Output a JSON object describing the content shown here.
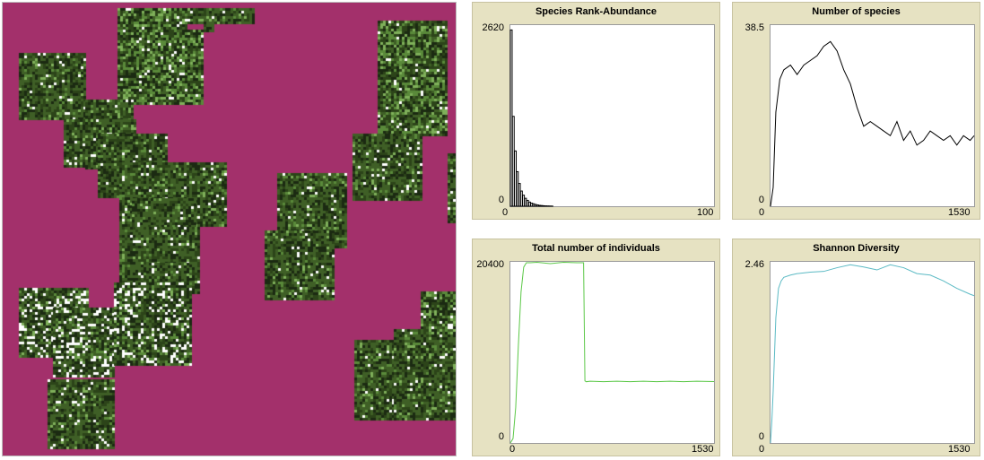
{
  "world": {
    "background": "#a3306b",
    "patch_colors": [
      "#1b2a12",
      "#2c4419",
      "#3f5f26",
      "#5a8a3a",
      "#7fb05a",
      "#ffffff"
    ]
  },
  "plots": [
    {
      "id": "rank",
      "title": "Species Rank-Abundance",
      "y_max_label": "2620",
      "y_min_label": "0",
      "x_min_label": "0",
      "x_max_label": "100",
      "color": "#000000",
      "chart_data": {
        "type": "bar",
        "x": [
          0,
          1,
          2,
          3,
          4,
          5,
          6,
          7,
          8,
          9,
          10,
          11,
          12,
          13,
          14,
          15,
          16,
          17,
          18,
          19,
          20
        ],
        "values": [
          2550,
          1300,
          800,
          500,
          330,
          220,
          160,
          115,
          85,
          60,
          45,
          35,
          25,
          18,
          13,
          10,
          7,
          5,
          4,
          3,
          2
        ],
        "xlim": [
          0,
          100
        ],
        "ylim": [
          0,
          2620
        ]
      }
    },
    {
      "id": "species",
      "title": "Number of species",
      "y_max_label": "38.5",
      "y_min_label": "0",
      "x_min_label": "0",
      "x_max_label": "1530",
      "color": "#000000",
      "chart_data": {
        "type": "line",
        "x": [
          0,
          20,
          40,
          70,
          100,
          150,
          200,
          250,
          300,
          350,
          400,
          450,
          500,
          550,
          600,
          650,
          700,
          750,
          800,
          850,
          900,
          950,
          1000,
          1050,
          1100,
          1150,
          1200,
          1250,
          1300,
          1350,
          1400,
          1450,
          1500,
          1530
        ],
        "y": [
          0,
          4,
          20,
          27,
          29,
          30,
          28,
          30,
          31,
          32,
          34,
          35,
          33,
          29,
          26,
          21,
          17,
          18,
          17,
          16,
          15,
          18,
          14,
          16,
          13,
          14,
          16,
          15,
          14,
          15,
          13,
          15,
          14,
          15
        ],
        "xlim": [
          0,
          1530
        ],
        "ylim": [
          0,
          38.5
        ]
      }
    },
    {
      "id": "individuals",
      "title": "Total number of individuals",
      "y_max_label": "20400",
      "y_min_label": "0",
      "x_min_label": "0",
      "x_max_label": "1530",
      "color": "#5cc848",
      "chart_data": {
        "type": "line",
        "x": [
          0,
          20,
          40,
          60,
          80,
          100,
          120,
          150,
          200,
          300,
          400,
          500,
          550,
          560,
          570,
          600,
          700,
          800,
          900,
          1000,
          1100,
          1200,
          1300,
          1400,
          1530
        ],
        "y": [
          0,
          500,
          4000,
          11000,
          17000,
          19800,
          20300,
          20300,
          20350,
          20200,
          20350,
          20300,
          20300,
          7000,
          6900,
          6950,
          6900,
          6950,
          6900,
          6950,
          6900,
          6950,
          6900,
          6950,
          6920
        ],
        "xlim": [
          0,
          1530
        ],
        "ylim": [
          0,
          20400
        ]
      }
    },
    {
      "id": "shannon",
      "title": "Shannon Diversity",
      "y_max_label": "2.46",
      "y_min_label": "0",
      "x_min_label": "0",
      "x_max_label": "1530",
      "color": "#5bbac4",
      "chart_data": {
        "type": "line",
        "x": [
          0,
          10,
          20,
          40,
          60,
          80,
          100,
          150,
          200,
          300,
          400,
          500,
          600,
          700,
          800,
          900,
          1000,
          1100,
          1200,
          1300,
          1400,
          1500,
          1530
        ],
        "y": [
          0,
          0.3,
          0.7,
          1.7,
          2.1,
          2.2,
          2.25,
          2.28,
          2.3,
          2.32,
          2.33,
          2.38,
          2.42,
          2.39,
          2.35,
          2.42,
          2.38,
          2.3,
          2.28,
          2.2,
          2.1,
          2.02,
          2.0
        ],
        "xlim": [
          0,
          1530
        ],
        "ylim": [
          0,
          2.46
        ]
      }
    }
  ]
}
